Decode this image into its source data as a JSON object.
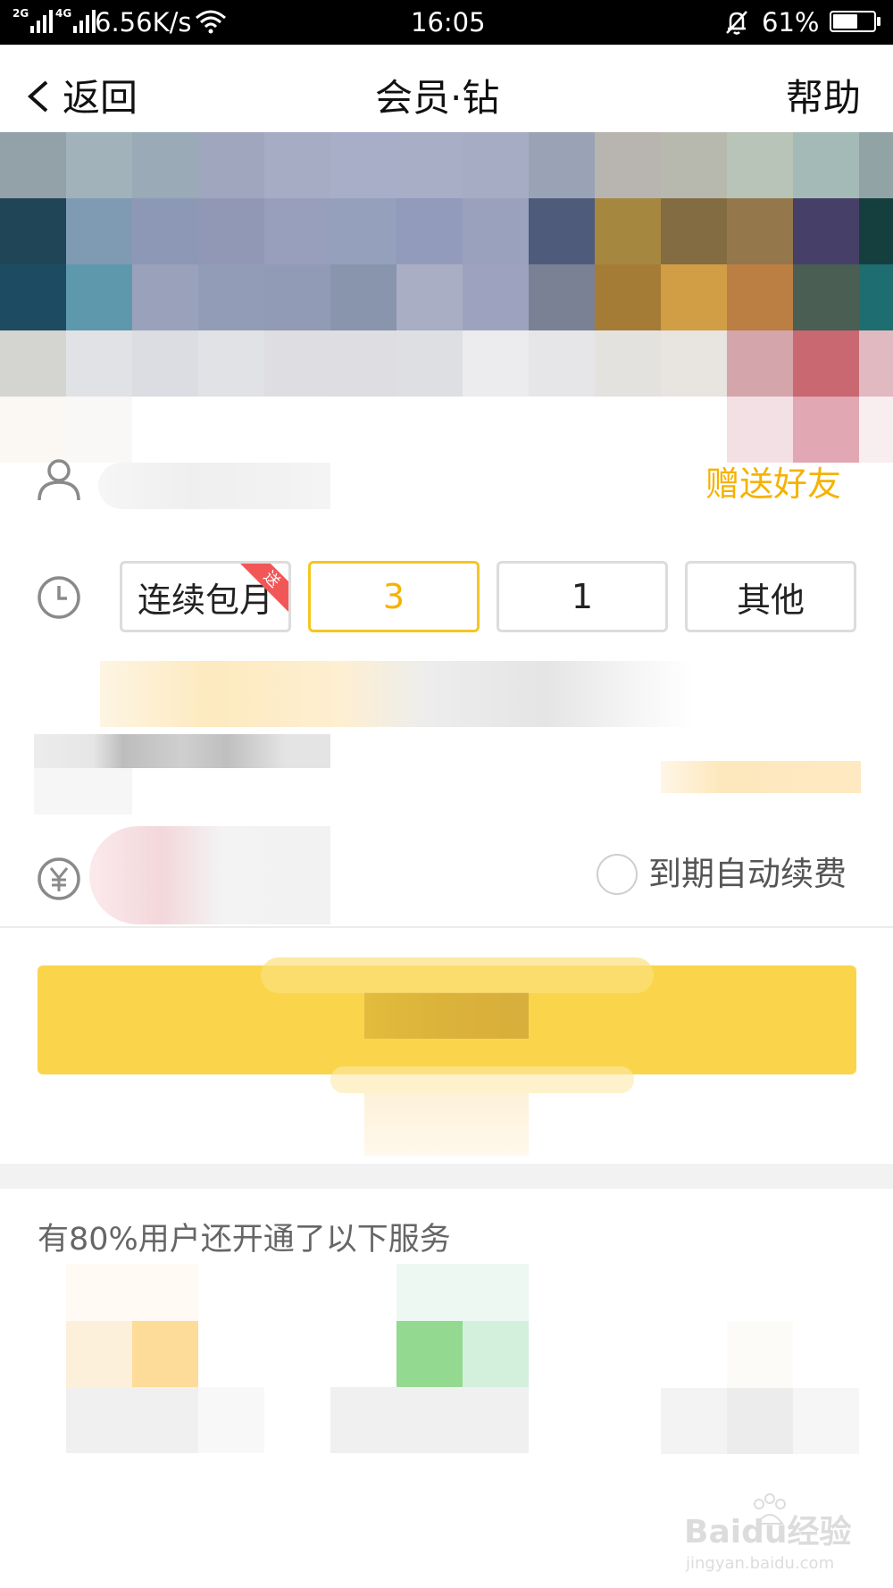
{
  "status_bar": {
    "network_2g": "2G",
    "network_4g": "4G",
    "speed": "6.56K/s",
    "time": "16:05",
    "battery_percent": "61%",
    "battery_level": 0.61
  },
  "header": {
    "back_label": "返回",
    "title": "会员·钻",
    "help_label": "帮助"
  },
  "gift": {
    "label": "赠送好友"
  },
  "duration": {
    "options": [
      {
        "label": "连续包月",
        "badge": "送",
        "selected": false
      },
      {
        "label": "3",
        "selected": true
      },
      {
        "label": "1",
        "selected": false
      },
      {
        "label": "其他",
        "selected": false
      }
    ]
  },
  "auto_renew": {
    "label": "到期自动续费",
    "checked": false
  },
  "services": {
    "heading": "有80%用户还开通了以下服务"
  },
  "watermark": {
    "text": "Baidu经验",
    "url": "jingyan.baidu.com"
  },
  "colors": {
    "accent_yellow": "#fad54c",
    "accent_text": "#f5b200",
    "badge_red": "#f25757"
  }
}
